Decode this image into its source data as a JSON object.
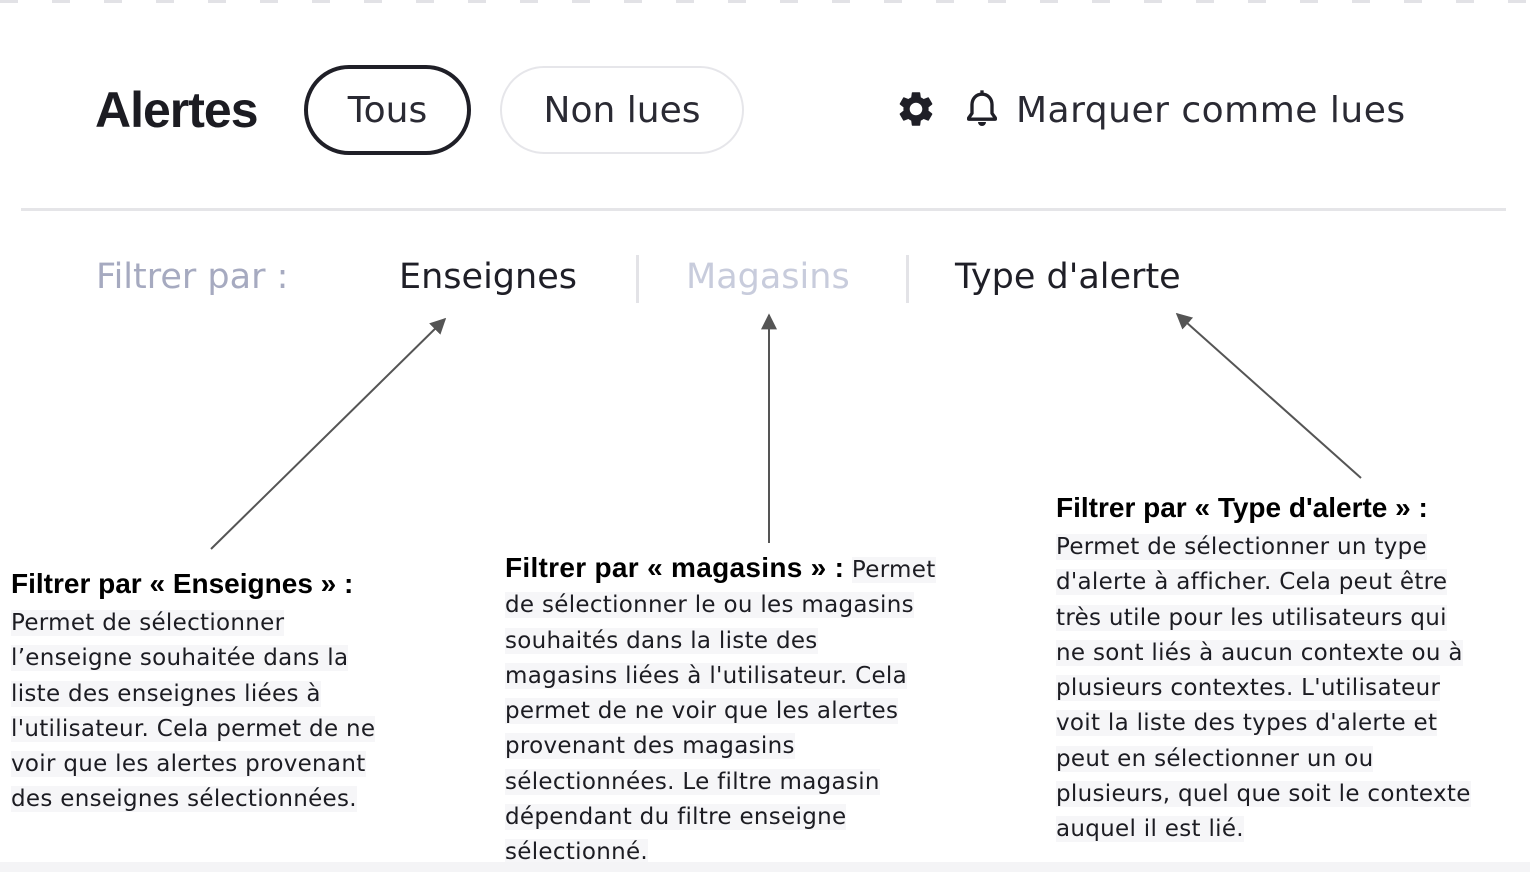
{
  "header": {
    "title": "Alertes",
    "tabs": [
      {
        "label": "Tous",
        "selected": true
      },
      {
        "label": "Non lues",
        "selected": false
      }
    ],
    "settings_icon": "gear-icon",
    "mark_read": {
      "icon": "bell-icon",
      "label": "Marquer comme lues"
    }
  },
  "filters": {
    "label": "Filtrer par :",
    "items": [
      {
        "label": "Enseignes",
        "state": "active"
      },
      {
        "label": "Magasins",
        "state": "disabled"
      },
      {
        "label": "Type d'alerte",
        "state": "active"
      }
    ]
  },
  "annotations": [
    {
      "title": "Filtrer par « Enseignes » :",
      "lines": [
        "Permet de sélectionner",
        "l’enseigne souhaitée dans la",
        "liste des enseignes liées à",
        "l'utilisateur. Cela permet de ne",
        "voir que les alertes provenant",
        "des enseignes sélectionnées."
      ]
    },
    {
      "title": "Filtrer par « magasins » :",
      "lines": [
        "Permet",
        "de sélectionner le ou les magasins",
        "souhaités dans la liste des",
        "magasins liées à l'utilisateur. Cela",
        "permet de ne voir que les alertes",
        "provenant des magasins",
        "sélectionnées. Le filtre magasin",
        "dépendant du filtre enseigne",
        "sélectionné."
      ]
    },
    {
      "title": "Filtrer par « Type d'alerte » :",
      "lines": [
        "Permet de sélectionner un type",
        "d'alerte à afficher. Cela peut être",
        "très utile pour les utilisateurs qui",
        "ne sont liés à aucun contexte ou à",
        "plusieurs contextes. L'utilisateur",
        "voit la liste des types d'alerte et",
        "peut en sélectionner un ou",
        "plusieurs, quel que soit le contexte",
        "auquel il est lié."
      ]
    }
  ],
  "colors": {
    "text_dark": "#1f1f27",
    "filter_label": "#a6aac0",
    "filter_disabled": "#c8ccdc",
    "divider": "#e5e5e8",
    "arrow": "#555555"
  }
}
